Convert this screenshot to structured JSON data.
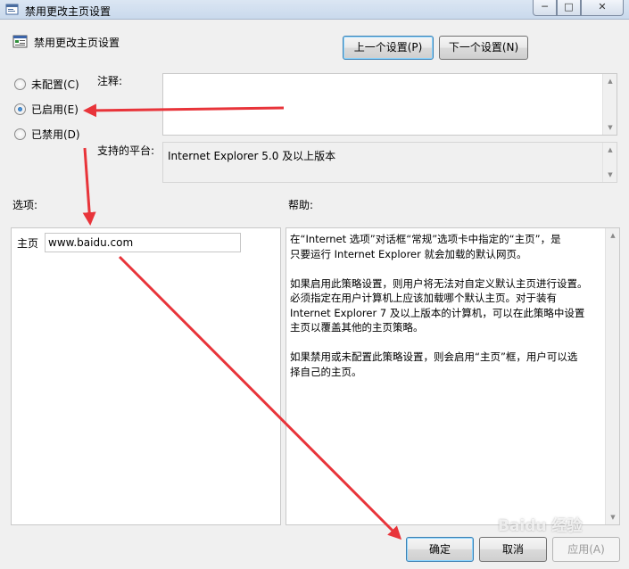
{
  "window": {
    "title": "禁用更改主页设置",
    "controls": {
      "minimize": "─",
      "maximize": "□",
      "close": "✕"
    }
  },
  "header": {
    "title": "禁用更改主页设置",
    "prev_button": "上一个设置(P)",
    "next_button": "下一个设置(N)"
  },
  "state": {
    "options": [
      {
        "label": "未配置(C)",
        "checked": false
      },
      {
        "label": "已启用(E)",
        "checked": true
      },
      {
        "label": "已禁用(D)",
        "checked": false
      }
    ]
  },
  "comment": {
    "label": "注释:",
    "value": ""
  },
  "platform": {
    "label": "支持的平台:",
    "value": "Internet Explorer 5.0 及以上版本"
  },
  "options_section": {
    "label": "选项:",
    "home_label": "主页",
    "home_value": "www.baidu.com"
  },
  "help_section": {
    "label": "帮助:",
    "text": "在“Internet 选项”对话框“常规”选项卡中指定的“主页”，是\n只要运行 Internet Explorer 就会加载的默认网页。\n\n如果启用此策略设置，则用户将无法对自定义默认主页进行设置。\n必须指定在用户计算机上应该加载哪个默认主页。对于装有\nInternet Explorer 7 及以上版本的计算机，可以在此策略中设置\n主页以覆盖其他的主页策略。\n\n如果禁用或未配置此策略设置，则会启用“主页”框，用户可以选\n择自己的主页。"
  },
  "footer": {
    "ok": "确定",
    "cancel": "取消",
    "apply": "应用(A)"
  },
  "watermark": "Baidu 经验",
  "colors": {
    "annotation_arrow": "#e8343a",
    "accent_border": "#3c7fb1"
  }
}
